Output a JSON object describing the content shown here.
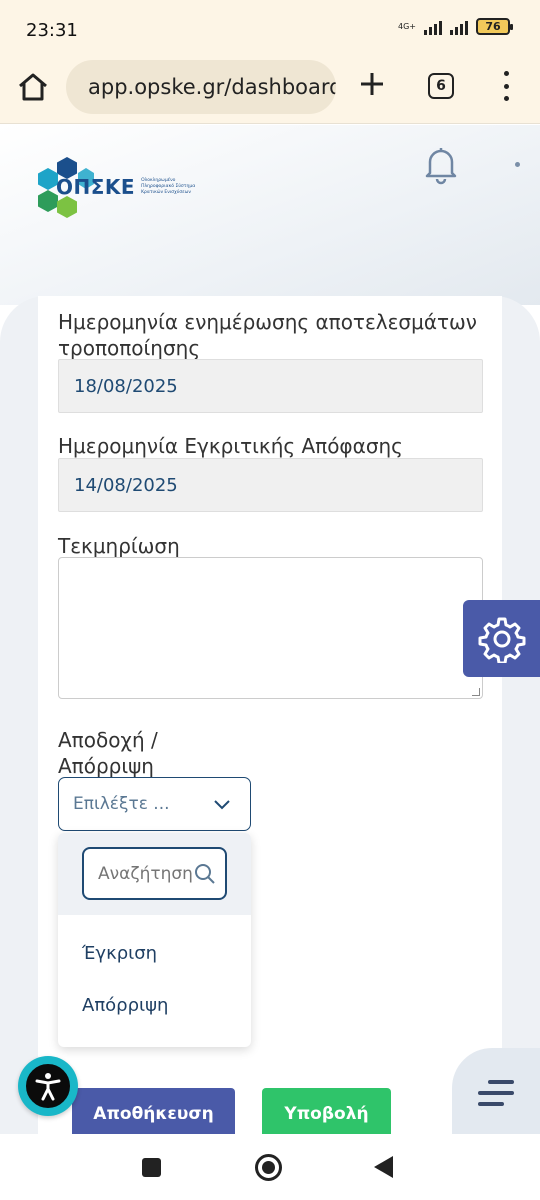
{
  "status_bar": {
    "time": "23:31",
    "network": "4G+",
    "battery": "76"
  },
  "browser": {
    "url": "app.opske.gr/dashboard",
    "tab_count": "6"
  },
  "header": {
    "logo_text": "ΟΠΣΚΕ",
    "logo_subtitle": "Ολοκληρωμένο Πληροφοριακό Σύστημα Κρατικών Ενισχύσεων"
  },
  "form": {
    "update_date_label": "Ημερομηνία ενημέρωσης αποτελεσμάτων τροποποίησης",
    "update_date_value": "18/08/2025",
    "approval_date_label": "Ημερομηνία Εγκριτικής Απόφασης",
    "approval_date_value": "14/08/2025",
    "justification_label": "Τεκμηρίωση",
    "decision_label": "Αποδοχή / Απόρριψη",
    "decision_placeholder": "Επιλέξτε ..."
  },
  "dropdown": {
    "search_placeholder": "Αναζήτηση",
    "options": [
      "Έγκριση",
      "Απόρριψη"
    ]
  },
  "actions": {
    "save_label": "Αποθήκευση",
    "submit_label": "Υποβολή"
  },
  "colors": {
    "primary": "#4a5aa8",
    "success": "#2fc46a",
    "text_blue": "#1f4a73",
    "accessibility": "#19b7c8"
  }
}
